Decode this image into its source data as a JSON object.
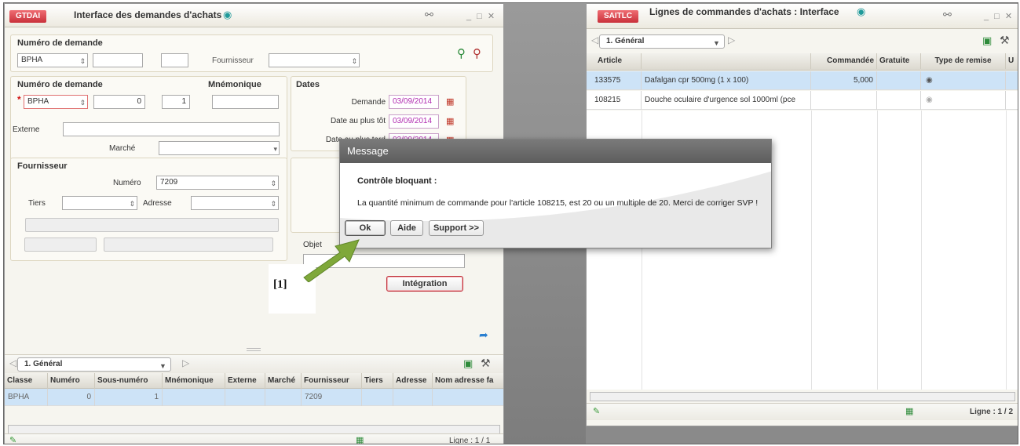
{
  "left_window": {
    "code": "GTDAI",
    "title": "Interface des demandes d'achats",
    "header_panel": {
      "label": "Numéro de demande",
      "class_value": "BPHA",
      "num_value": "",
      "sub_value": "",
      "supplier_label": "Fournisseur",
      "supplier_value": ""
    },
    "main_panel": {
      "num_label": "Numéro de demande",
      "class_value": "BPHA",
      "num_value": "0",
      "sub_value": "1",
      "mnemo_label": "Mnémonique",
      "mnemo_value": "",
      "externe_label": "Externe",
      "externe_value": "",
      "marche_label": "Marché",
      "marche_value": ""
    },
    "dates": {
      "title": "Dates",
      "demande_label": "Demande",
      "demande_value": "03/09/2014",
      "tot_label": "Date au plus tôt",
      "tot_value": "03/09/2014",
      "tard_label": "Date au plus tard",
      "tard_value": "03/09/2014"
    },
    "fournisseur": {
      "title": "Fournisseur",
      "numero_label": "Numéro",
      "numero_value": "7209",
      "tiers_label": "Tiers",
      "tiers_value": "",
      "adresse_label": "Adresse",
      "adresse_value": ""
    },
    "objet_label": "Objet",
    "integration_label": "Intégration",
    "tab_label": "1. Général",
    "grid": {
      "columns": [
        "Classe",
        "Numéro",
        "Sous-numéro",
        "Mnémonique",
        "Externe",
        "Marché",
        "Fournisseur",
        "Tiers",
        "Adresse",
        "Nom adresse fa"
      ],
      "rows": [
        [
          "BPHA",
          "0",
          "1",
          "",
          "",
          "",
          "7209",
          "",
          "",
          ""
        ]
      ]
    },
    "status_text": "Ligne : 1 / 1"
  },
  "right_window": {
    "code": "SAITLC",
    "title": "Lignes de commandes d'achats : Interface",
    "tab_label": "1. Général",
    "grid": {
      "columns": [
        "Article",
        "",
        "Commandée",
        "Gratuite",
        "Type de remise",
        "U"
      ],
      "rows": [
        [
          "133575",
          "Dafalgan cpr 500mg (1 x 100)",
          "5,000",
          "",
          "",
          ""
        ],
        [
          "108215",
          "Douche oculaire d'urgence sol 1000ml (pce",
          "",
          "",
          "",
          ""
        ]
      ]
    },
    "status_text": "Ligne : 1 / 2"
  },
  "dialog": {
    "title": "Message",
    "heading": "Contrôle bloquant :",
    "message": "La quantité minimum de commande pour l'article 108215, est 20 ou un multiple de 20. Merci de corriger SVP !",
    "buttons": {
      "ok": "Ok",
      "aide": "Aide",
      "support": "Support >>"
    }
  },
  "annotation": {
    "label": "[1]",
    "arrow_color": "#7fa83a"
  }
}
